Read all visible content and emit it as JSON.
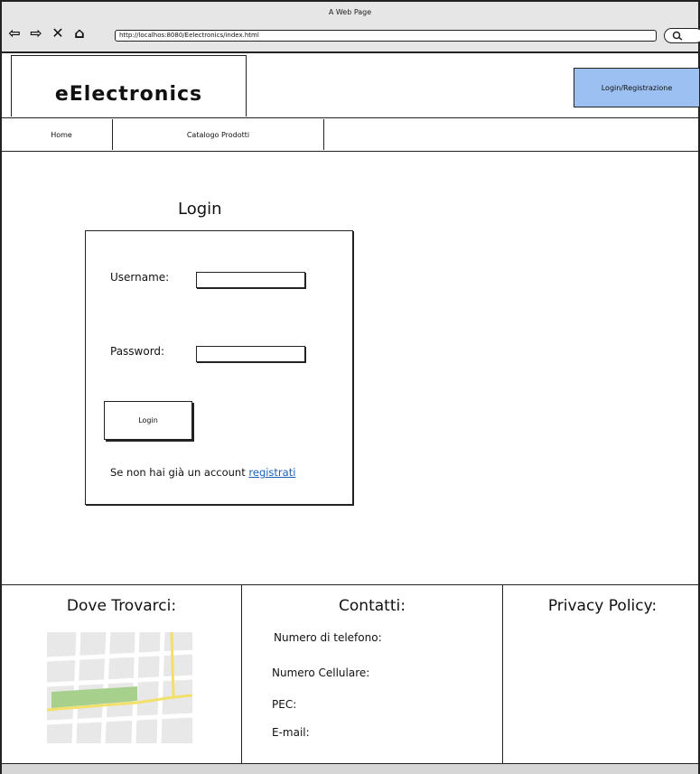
{
  "browser": {
    "window_title": "A Web Page",
    "url": "http://localhos:8080/Eelectronics/index.html"
  },
  "header": {
    "logo": "eElectronics",
    "login_button": "Login/Registrazione"
  },
  "menu": {
    "items": [
      "Home",
      "Catalogo Prodotti"
    ]
  },
  "login": {
    "title": "Login",
    "username_label": "Username:",
    "username_value": "",
    "password_label": "Password:",
    "password_value": "",
    "submit_label": "Login",
    "register_prompt": "Se non hai già un account",
    "register_link": "registrati"
  },
  "footer": {
    "location_heading": "Dove Trovarci:",
    "contacts_heading": "Contatti:",
    "contacts": [
      "Numero di telefono:",
      "Numero Cellulare:",
      "PEC:",
      "E-mail:"
    ],
    "privacy_heading": "Privacy Policy:"
  },
  "colors": {
    "login_button_bg": "#9cc0f2",
    "link": "#1a5fb4",
    "map_park": "#a8d08d",
    "map_road_main": "#f2e06b"
  }
}
